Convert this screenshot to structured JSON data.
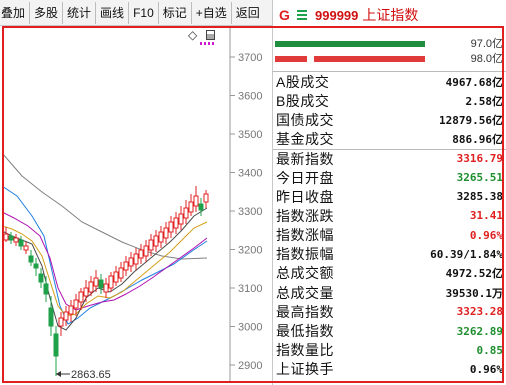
{
  "toolbar": {
    "items": [
      "叠加",
      "多股",
      "统计",
      "画线",
      "F10",
      "标记",
      "+自选",
      "返回"
    ]
  },
  "chart": {
    "y_ticks": [
      "3700",
      "3600",
      "3500",
      "3400",
      "3300",
      "3200",
      "3100",
      "3000",
      "2900"
    ],
    "low_label": "2863.65",
    "ma_colors": {
      "ma5": "#4a4a4a",
      "ma10": "#d4a017",
      "ma20": "#b010b0",
      "ma60": "#1e7fe0",
      "ma120": "#808080"
    },
    "candle_up": "#e02020",
    "candle_down": "#1fa04a"
  },
  "header": {
    "g_label": "G",
    "menu_icon": "list-icon",
    "code": "999999",
    "name": "上证指数"
  },
  "bars": [
    {
      "percent_text": "97.0亿",
      "segments": [
        {
          "color": "#1f8f3f",
          "fraction": 1.0
        }
      ]
    },
    {
      "percent_text": "98.0亿",
      "segments": [
        {
          "color": "#e03a3a",
          "fraction": 0.21
        },
        {
          "color": "#ffffff",
          "fraction": 0.05
        },
        {
          "color": "#e03a3a",
          "fraction": 0.74
        }
      ]
    }
  ],
  "stats": [
    {
      "label": "A股成交",
      "value": "4967.68亿",
      "color": "black"
    },
    {
      "label": "B股成交",
      "value": "2.58亿",
      "color": "black"
    },
    {
      "label": "国债成交",
      "value": "12879.56亿",
      "color": "black"
    },
    {
      "label": "基金成交",
      "value": "886.96亿",
      "color": "black"
    },
    {
      "label": "最新指数",
      "value": "3316.79",
      "color": "red"
    },
    {
      "label": "今日开盘",
      "value": "3265.51",
      "color": "green"
    },
    {
      "label": "昨日收盘",
      "value": "3285.38",
      "color": "black"
    },
    {
      "label": "指数涨跌",
      "value": "31.41",
      "color": "red"
    },
    {
      "label": "指数涨幅",
      "value": "0.96%",
      "color": "red"
    },
    {
      "label": "指数振幅",
      "value": "60.39/1.84%",
      "color": "black"
    },
    {
      "label": "总成交额",
      "value": "4972.52亿",
      "color": "black"
    },
    {
      "label": "总成交量",
      "value": "39530.1万",
      "color": "black"
    },
    {
      "label": "最高指数",
      "value": "3323.28",
      "color": "red"
    },
    {
      "label": "最低指数",
      "value": "3262.89",
      "color": "green"
    },
    {
      "label": "指数量比",
      "value": "0.85",
      "color": "green"
    },
    {
      "label": "上证换手",
      "value": "0.96%",
      "color": "black"
    }
  ]
}
